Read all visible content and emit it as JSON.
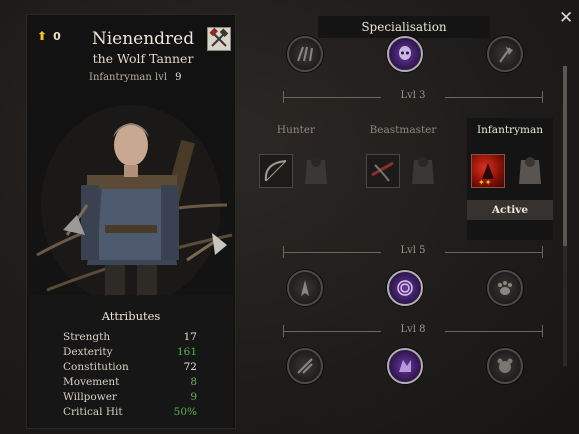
{
  "character": {
    "points_value": "0",
    "name": "Nienendred",
    "title": "the Wolf Tanner",
    "class_label": "Infantryman lvl",
    "class_level": "9"
  },
  "attributes": {
    "header": "Attributes",
    "rows": [
      {
        "label": "Strength",
        "value": "17",
        "tone": "normal"
      },
      {
        "label": "Dexterity",
        "value": "161",
        "tone": "green"
      },
      {
        "label": "Constitution",
        "value": "72",
        "tone": "normal"
      },
      {
        "label": "Movement",
        "value": "8",
        "tone": "green"
      },
      {
        "label": "Willpower",
        "value": "9",
        "tone": "green"
      },
      {
        "label": "Critical Hit",
        "value": "50%",
        "tone": "green"
      }
    ]
  },
  "specialisation": {
    "header": "Specialisation",
    "close_glyph": "✕",
    "levels": [
      {
        "label": "Lvl 3"
      },
      {
        "label": "Lvl 5"
      },
      {
        "label": "Lvl 8"
      }
    ],
    "classes": [
      {
        "name": "Hunter",
        "selected": false
      },
      {
        "name": "Beastmaster",
        "selected": false
      },
      {
        "name": "Infantryman",
        "selected": true
      }
    ],
    "active_label": "Active"
  },
  "colors": {
    "accent_green": "#5fb34c",
    "active_purple": "#6c3aa0",
    "skill_red": "#e03020"
  },
  "icons": {
    "points": "arrow-up-icon",
    "badge": "crossed-hammers-icon",
    "close": "close-icon"
  }
}
